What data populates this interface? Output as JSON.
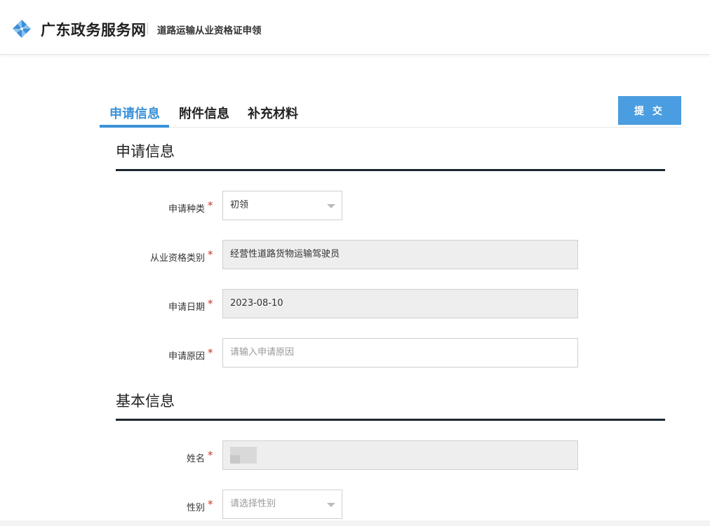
{
  "header": {
    "brand": "广东政务服务网",
    "subtitle": "道路运输从业资格证申领",
    "logo_icon": "pinwheel-logo-icon"
  },
  "tabs": [
    {
      "label": "申请信息",
      "active": true
    },
    {
      "label": "附件信息",
      "active": false
    },
    {
      "label": "补充材料",
      "active": false
    }
  ],
  "submit_label": "提 交",
  "sections": {
    "application": {
      "title": "申请信息",
      "fields": {
        "apply_type": {
          "label": "申请种类",
          "value": "初领"
        },
        "qual_category": {
          "label": "从业资格类别",
          "value": "经营性道路货物运输驾驶员"
        },
        "apply_date": {
          "label": "申请日期",
          "value": "2023-08-10"
        },
        "apply_reason": {
          "label": "申请原因",
          "placeholder": "请输入申请原因"
        }
      }
    },
    "basic": {
      "title": "基本信息",
      "fields": {
        "name": {
          "label": "姓名",
          "value": ""
        },
        "gender": {
          "label": "性别",
          "placeholder": "请选择性别"
        }
      }
    }
  },
  "required_mark": "*",
  "colors": {
    "accent": "#3a92d8",
    "button": "#4a9de0",
    "required": "#c0392b",
    "rule": "#1c2630",
    "disabled_bg": "#eeeeee"
  }
}
